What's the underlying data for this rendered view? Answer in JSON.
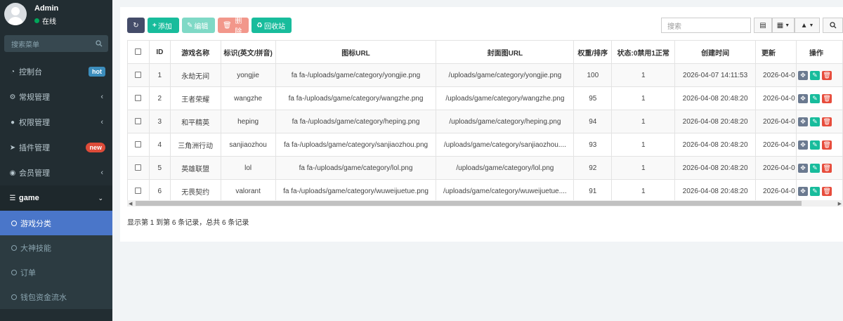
{
  "user": {
    "name": "Admin",
    "status": "在线"
  },
  "sidebar": {
    "search_placeholder": "搜索菜单",
    "items": [
      {
        "label": "控制台",
        "badge": "hot"
      },
      {
        "label": "常规管理"
      },
      {
        "label": "权限管理"
      },
      {
        "label": "插件管理",
        "badge": "new"
      },
      {
        "label": "会员管理"
      },
      {
        "label": "game"
      }
    ],
    "sub_items": [
      {
        "label": "游戏分类"
      },
      {
        "label": "大神技能"
      },
      {
        "label": "订单"
      },
      {
        "label": "钱包资金流水"
      }
    ]
  },
  "toolbar": {
    "add": "添加",
    "edit": "编辑",
    "delete": "删除",
    "recycle": "回收站",
    "search_placeholder": "搜索"
  },
  "table": {
    "headers": [
      "ID",
      "游戏名称",
      "标识(英文/拼音)",
      "图标URL",
      "封面图URL",
      "权重/排序",
      "状态:0禁用1正常",
      "创建时间",
      "更新",
      "操作"
    ],
    "rows": [
      [
        "1",
        "永劫无间",
        "yongjie",
        "fa fa-/uploads/game/category/yongjie.png",
        "/uploads/game/category/yongjie.png",
        "100",
        "1",
        "2026-04-07 14:11:53",
        "2026-04-0"
      ],
      [
        "2",
        "王者荣耀",
        "wangzhe",
        "fa fa-/uploads/game/category/wangzhe.png",
        "/uploads/game/category/wangzhe.png",
        "95",
        "1",
        "2026-04-08 20:48:20",
        "2026-04-0"
      ],
      [
        "3",
        "和平精英",
        "heping",
        "fa fa-/uploads/game/category/heping.png",
        "/uploads/game/category/heping.png",
        "94",
        "1",
        "2026-04-08 20:48:20",
        "2026-04-0"
      ],
      [
        "4",
        "三角洲行动",
        "sanjiaozhou",
        "fa fa-/uploads/game/category/sanjiaozhou.png",
        "/uploads/game/category/sanjiaozhou....",
        "93",
        "1",
        "2026-04-08 20:48:20",
        "2026-04-0"
      ],
      [
        "5",
        "英雄联盟",
        "lol",
        "fa fa-/uploads/game/category/lol.png",
        "/uploads/game/category/lol.png",
        "92",
        "1",
        "2026-04-08 20:48:20",
        "2026-04-0"
      ],
      [
        "6",
        "无畏契约",
        "valorant",
        "fa fa-/uploads/game/category/wuweijuetue.png",
        "/uploads/game/category/wuweijuetue....",
        "91",
        "1",
        "2026-04-08 20:48:20",
        "2026-04-0"
      ]
    ]
  },
  "footer": {
    "info": "显示第 1 到第 6 条记录，总共 6 条记录"
  },
  "colors": {
    "sidebar_bg": "#222d32",
    "active": "#4a76c9",
    "success": "#18bc9c",
    "danger": "#e74c3c"
  }
}
